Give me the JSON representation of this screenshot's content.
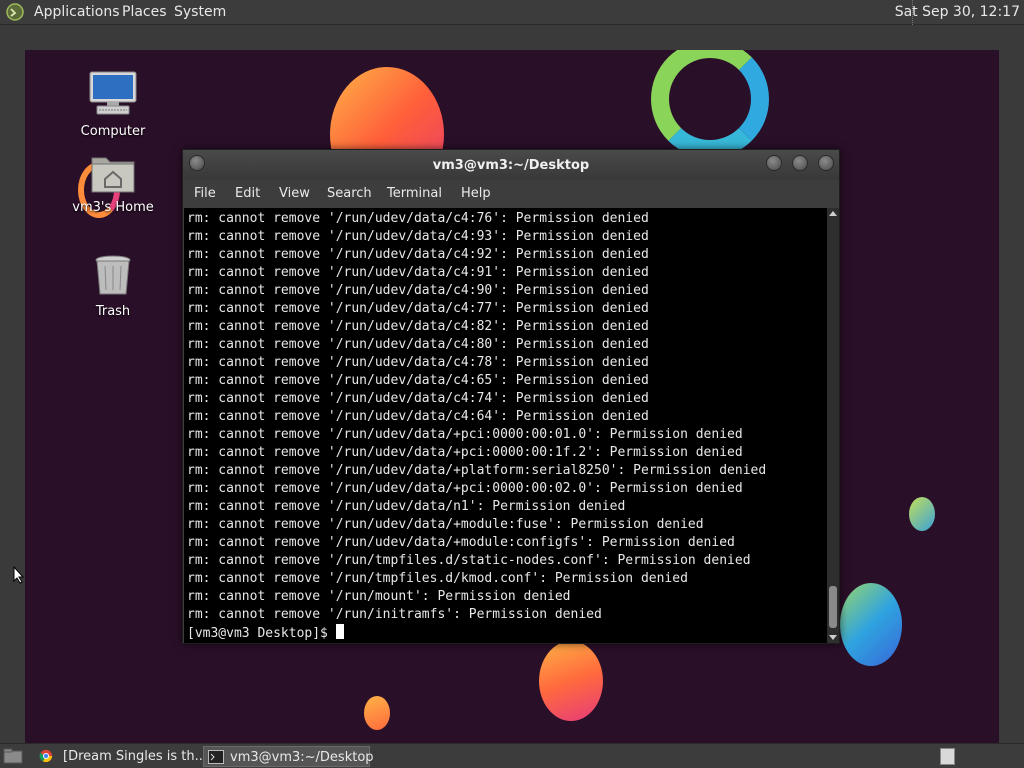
{
  "top_panel": {
    "menus": [
      "Applications",
      "Places",
      "System"
    ],
    "clock": "Sat Sep 30, 12:17"
  },
  "desktop": {
    "icons": [
      {
        "label": "Computer",
        "icon": "computer-icon"
      },
      {
        "label": "vm3's Home",
        "icon": "home-folder-icon"
      },
      {
        "label": "Trash",
        "icon": "trash-icon"
      }
    ]
  },
  "terminal": {
    "title": "vm3@vm3:~/Desktop",
    "menu": [
      "File",
      "Edit",
      "View",
      "Search",
      "Terminal",
      "Help"
    ],
    "lines": [
      "rm: cannot remove '/run/udev/data/c4:76': Permission denied",
      "rm: cannot remove '/run/udev/data/c4:93': Permission denied",
      "rm: cannot remove '/run/udev/data/c4:92': Permission denied",
      "rm: cannot remove '/run/udev/data/c4:91': Permission denied",
      "rm: cannot remove '/run/udev/data/c4:90': Permission denied",
      "rm: cannot remove '/run/udev/data/c4:77': Permission denied",
      "rm: cannot remove '/run/udev/data/c4:82': Permission denied",
      "rm: cannot remove '/run/udev/data/c4:80': Permission denied",
      "rm: cannot remove '/run/udev/data/c4:78': Permission denied",
      "rm: cannot remove '/run/udev/data/c4:65': Permission denied",
      "rm: cannot remove '/run/udev/data/c4:74': Permission denied",
      "rm: cannot remove '/run/udev/data/c4:64': Permission denied",
      "rm: cannot remove '/run/udev/data/+pci:0000:00:01.0': Permission denied",
      "rm: cannot remove '/run/udev/data/+pci:0000:00:1f.2': Permission denied",
      "rm: cannot remove '/run/udev/data/+platform:serial8250': Permission denied",
      "rm: cannot remove '/run/udev/data/+pci:0000:00:02.0': Permission denied",
      "rm: cannot remove '/run/udev/data/n1': Permission denied",
      "rm: cannot remove '/run/udev/data/+module:fuse': Permission denied",
      "rm: cannot remove '/run/udev/data/+module:configfs': Permission denied",
      "rm: cannot remove '/run/tmpfiles.d/static-nodes.conf': Permission denied",
      "rm: cannot remove '/run/tmpfiles.d/kmod.conf': Permission denied",
      "rm: cannot remove '/run/mount': Permission denied",
      "rm: cannot remove '/run/initramfs': Permission denied"
    ],
    "prompt": "[vm3@vm3 Desktop]$ "
  },
  "taskbar": {
    "tasks": [
      {
        "label": "[Dream Singles is th...",
        "icon": "chrome-icon"
      },
      {
        "label": "vm3@vm3:~/Desktop",
        "icon": "terminal-icon"
      }
    ]
  },
  "colors": {
    "desktop_bg": "#2a0f28",
    "panel_bg": "#3c3c3c",
    "terminal_bg": "#000000",
    "terminal_fg": "#e8e8e8"
  }
}
